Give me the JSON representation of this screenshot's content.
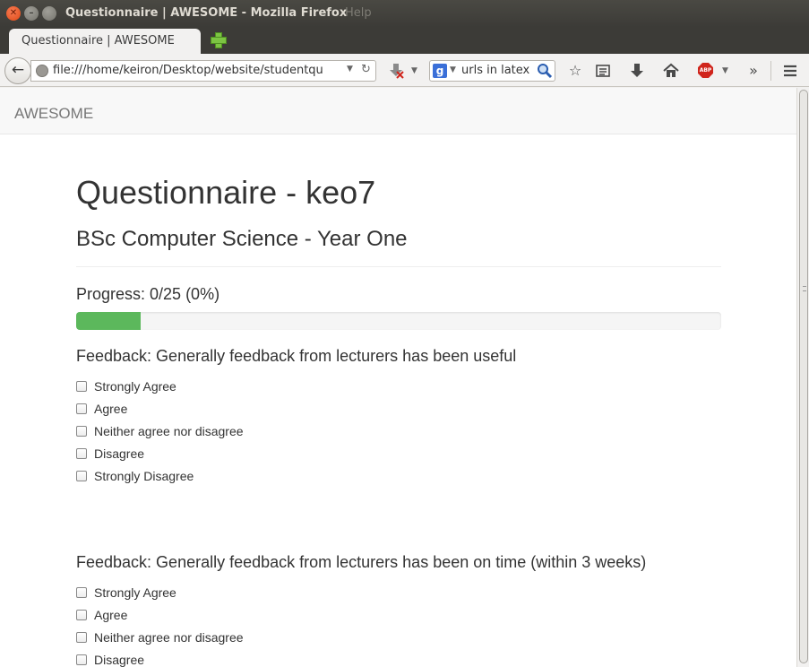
{
  "window": {
    "title": "Questionnaire | AWESOME - Mozilla Firefox",
    "help_menu": "Help"
  },
  "tab": {
    "label": "Questionnaire | AWESOME"
  },
  "nav": {
    "url": "file:///home/keiron/Desktop/website/studentqu",
    "search_value": "urls in latex",
    "search_engine_icon": "google-icon",
    "abp_label": "ABP"
  },
  "site": {
    "brand": "AWESOME",
    "heading": "Questionnaire - keo7",
    "subheading": "BSc Computer Science - Year One",
    "progress_label": "Progress: 0/25 (0%)",
    "progress_fill_fraction": 0.1
  },
  "questions": [
    {
      "title": "Feedback: Generally feedback from lecturers has been useful",
      "options": [
        "Strongly Agree",
        "Agree",
        "Neither agree nor disagree",
        "Disagree",
        "Strongly Disagree"
      ]
    },
    {
      "title": "Feedback: Generally feedback from lecturers has been on time (within 3 weeks)",
      "options": [
        "Strongly Agree",
        "Agree",
        "Neither agree nor disagree",
        "Disagree"
      ]
    }
  ],
  "colors": {
    "progress": "#5cb85c",
    "titlebar": "#3c3b37",
    "close_button": "#df4a16"
  }
}
